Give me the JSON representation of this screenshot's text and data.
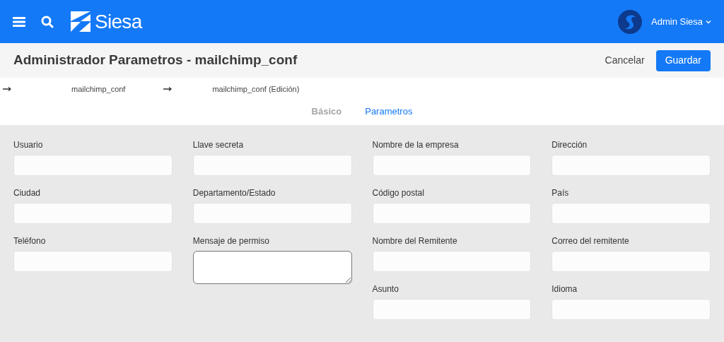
{
  "header": {
    "brand": "Siesa",
    "user": "Admin Siesa"
  },
  "toolbar": {
    "title": "Administrador Parametros - mailchimp_conf",
    "buttons": [
      {
        "label": "Cancelar",
        "kind": "link"
      },
      {
        "label": "Guardar",
        "kind": "primary"
      }
    ]
  },
  "breadcrumb": [
    "mailchimp_conf",
    "mailchimp_conf (Edición)"
  ],
  "tabs": [
    {
      "label": "Básico",
      "selected": false
    },
    {
      "label": "Parametros",
      "selected": true
    }
  ],
  "form_columns": [
    [
      {
        "label": "Usuario",
        "kind": "input"
      },
      {
        "label": "Ciudad",
        "kind": "input"
      },
      {
        "label": "Teléfono",
        "kind": "input"
      }
    ],
    [
      {
        "label": "Llave secreta",
        "kind": "input"
      },
      {
        "label": "Departamento/Estado",
        "kind": "input"
      },
      {
        "label": "Mensaje de permiso",
        "kind": "textarea"
      }
    ],
    [
      {
        "label": "Nombre de la empresa",
        "kind": "input"
      },
      {
        "label": "Código postal",
        "kind": "input"
      },
      {
        "label": "Nombre del Remitente",
        "kind": "input"
      },
      {
        "label": "Asunto",
        "kind": "input"
      }
    ],
    [
      {
        "label": "Dirección",
        "kind": "input"
      },
      {
        "label": "País",
        "kind": "input"
      },
      {
        "label": "Correo del remitente",
        "kind": "input"
      },
      {
        "label": "Idioma",
        "kind": "input"
      }
    ]
  ]
}
